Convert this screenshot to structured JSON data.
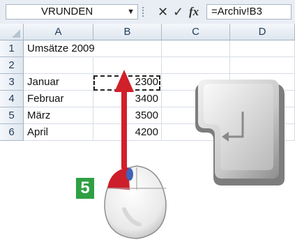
{
  "formula_bar": {
    "name_box": "VRUNDEN",
    "formula": "=Archiv!B3",
    "cancel_glyph": "✕",
    "enter_glyph": "✓",
    "fx_label": "fx"
  },
  "sheet": {
    "columns": [
      "A",
      "B",
      "C",
      "D"
    ],
    "rows": [
      "1",
      "2",
      "3",
      "4",
      "5",
      "6"
    ],
    "cells": {
      "A1": "Umsätze 2009",
      "A3": "Januar",
      "A4": "Februar",
      "A5": "März",
      "A6": "April",
      "B3": "2300",
      "B4": "3400",
      "B5": "3500",
      "B6": "4200"
    }
  },
  "step_badge": "5",
  "icons": {
    "enter_key": "enter-key-icon",
    "mouse": "mouse-icon",
    "arrow": "arrow-up-icon"
  },
  "colors": {
    "arrow": "#d0202a",
    "badge": "#2ea043",
    "mouse_button": "#cc1f2b"
  }
}
